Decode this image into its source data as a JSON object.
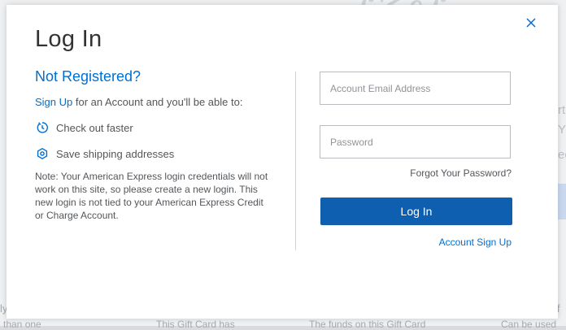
{
  "modal": {
    "title": "Log In",
    "subheading": "Not Registered?",
    "signup_link": "Sign Up",
    "signup_text": " for an Account and you'll be able to:",
    "benefits": [
      {
        "icon": "clock-icon",
        "label": "Check out faster"
      },
      {
        "icon": "gear-icon",
        "label": "Save shipping addresses"
      }
    ],
    "note": "Note: Your American Express login credentials will not work on this site, so please create a new login. This new login is not tied to your American Express Credit or Charge Account.",
    "email_placeholder": "Account Email Address",
    "password_placeholder": "Password",
    "forgot_password": "Forgot Your Password?",
    "login_button": "Log In",
    "account_signup": "Account Sign Up",
    "close_icon": "close-icon"
  },
  "colors": {
    "accent_blue": "#006fcf",
    "button_blue": "#0e5fb0",
    "text": "#53565a"
  }
}
